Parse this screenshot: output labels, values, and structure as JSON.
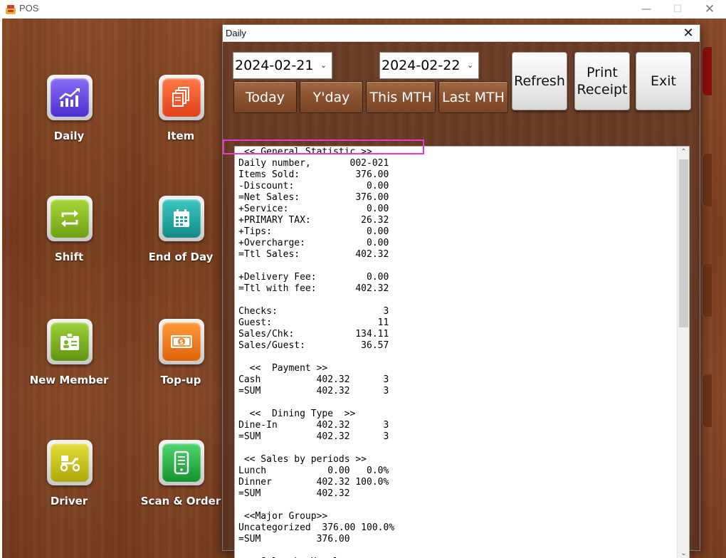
{
  "app": {
    "title": "POS",
    "minimize_icon": "minimize-icon",
    "maximize_icon": "maximize-icon",
    "close_icon": "close-icon"
  },
  "tiles": [
    {
      "label": "Daily",
      "icon": "chart-icon",
      "color": "#6a3fe0"
    },
    {
      "label": "Item",
      "icon": "documents-icon",
      "color": "#f05a28"
    },
    {
      "label": "Shift",
      "icon": "swap-icon",
      "color": "#8bbf1e"
    },
    {
      "label": "End of Day",
      "icon": "calendar-icon",
      "color": "#1aa7a0"
    },
    {
      "label": "New Member",
      "icon": "id-card-icon",
      "color": "#7cb51c"
    },
    {
      "label": "Top-up",
      "icon": "cash-icon",
      "color": "#f27a12"
    },
    {
      "label": "Driver",
      "icon": "scooter-icon",
      "color": "#c9c417"
    },
    {
      "label": "Scan & Order",
      "icon": "phone-icon",
      "color": "#24b34a"
    }
  ],
  "dialog": {
    "title": "Daily",
    "start_date": "2024-02-21",
    "end_date": "2024-02-22",
    "buttons": {
      "today": "Today",
      "yesterday": "Y'day",
      "this_month": "This MTH",
      "last_month": "Last MTH",
      "refresh": "Refresh",
      "print_receipt_1": "Print",
      "print_receipt_2": "Receipt",
      "exit": "Exit"
    },
    "report_lines": [
      " << General Statistic >>",
      "Daily number,       002-021",
      "Items Sold:          376.00",
      "-Discount:             0.00",
      "=Net Sales:          376.00",
      "+Service:              0.00",
      "+PRIMARY TAX:         26.32",
      "+Tips:                 0.00",
      "+Overcharge:           0.00",
      "=Ttl Sales:          402.32",
      "",
      "+Delivery Fee:         0.00",
      "=Ttl with fee:       402.32",
      "",
      "Checks:                   3",
      "Guest:                   11",
      "Sales/Chk:           134.11",
      "Sales/Guest:          36.57",
      "",
      "  <<  Payment >>",
      "Cash          402.32      3",
      "=SUM          402.32      3",
      "",
      "  <<  Dining Type  >>",
      "Dine-In       402.32      3",
      "=SUM          402.32      3",
      "",
      " << Sales by periods >>",
      "Lunch           0.00   0.0%",
      "Dinner        402.32 100.0%",
      "=SUM          402.32",
      "",
      " <<Major Group>>",
      "Uncategorized  376.00 100.0%",
      "=SUM          376.00",
      "",
      " << Sales by Hourly >>"
    ]
  },
  "colors": {
    "highlight": "#e53ad0",
    "wood": "#7b3f20"
  }
}
